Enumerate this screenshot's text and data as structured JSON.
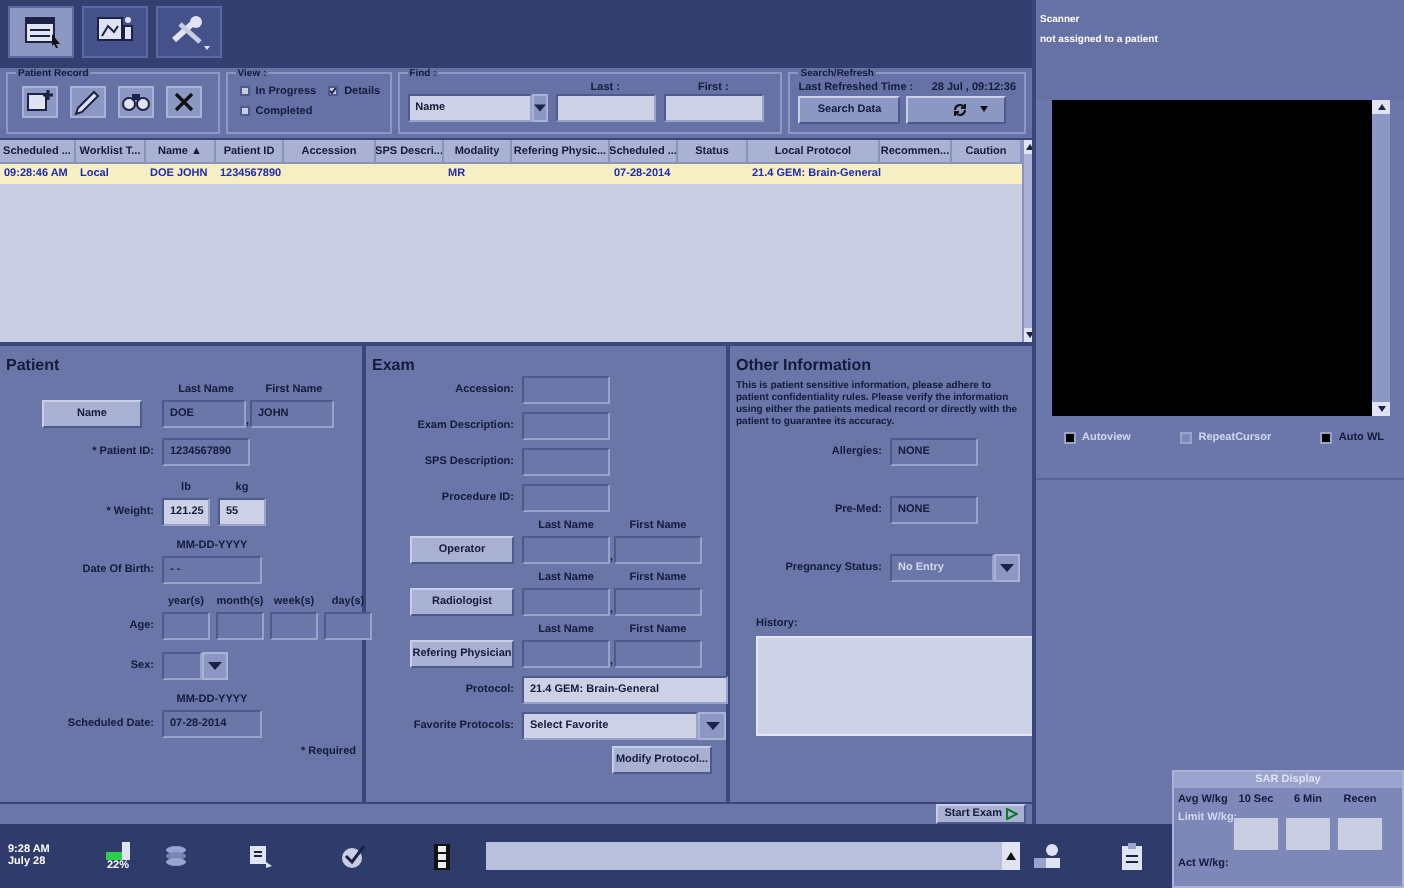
{
  "toolbar": [
    {
      "selected": true
    },
    {
      "selected": false
    },
    {
      "selected": false
    }
  ],
  "patient_record": {
    "title": "Patient Record"
  },
  "view": {
    "title": "View :",
    "options": [
      {
        "label": "In Progress",
        "checked": false
      },
      {
        "label": "Details",
        "checked": true
      },
      {
        "label": "Completed",
        "checked": false
      }
    ]
  },
  "find": {
    "title": "Find :",
    "field": "Name",
    "last_label": "Last :",
    "first_label": "First :"
  },
  "search_refresh": {
    "title": "Search/Refresh",
    "time_label": "Last Refreshed Time :",
    "time_value": "28 Jul , 09:12:36",
    "search_button": "Search Data"
  },
  "worklist": {
    "columns": [
      "Scheduled ...",
      "Worklist T...",
      "Name ▲",
      "Patient ID",
      "Accession",
      "SPS Descri...",
      "Modality",
      "Refering Physic...",
      "Scheduled ...",
      "Status",
      "Local Protocol",
      "Recommen...",
      "Caution"
    ],
    "rows": [
      {
        "selected": true,
        "scheduled_time": "09:28:46 AM",
        "worklist_type": "Local",
        "patient_name": "DOE JOHN",
        "patient_id": "1234567890",
        "modality": "MR",
        "scheduled_date": "07-28-2014",
        "local_protocol": "21.4 GEM: Brain-General"
      }
    ]
  },
  "patient": {
    "title": "Patient",
    "last_name_label": "Last Name",
    "first_name_label": "First Name",
    "name_button": "Name",
    "last_name": "DOE",
    "separator": ",",
    "first_name": "JOHN",
    "id_label": "* Patient ID:",
    "id": "1234567890",
    "lb_label": "lb",
    "kg_label": "kg",
    "weight_label": "* Weight:",
    "weight_lb": "121.25",
    "weight_kg": "55",
    "dob_format": "MM-DD-YYYY",
    "dob_label": "Date Of Birth:",
    "dob": "- -",
    "age_units": [
      "year(s)",
      "month(s)",
      "week(s)",
      "day(s)"
    ],
    "age_label": "Age:",
    "sex_label": "Sex:",
    "sched_format": "MM-DD-YYYY",
    "sched_label": "Scheduled Date:",
    "sched_date": "07-28-2014",
    "required_note": "* Required"
  },
  "exam": {
    "title": "Exam",
    "fields": [
      {
        "label": "Accession:"
      },
      {
        "label": "Exam Description:"
      },
      {
        "label": "SPS Description:"
      },
      {
        "label": "Procedure ID:"
      }
    ],
    "people": [
      {
        "button": "Operator",
        "last_label": "Last Name",
        "first_label": "First Name",
        "separator": ","
      },
      {
        "button": "Radiologist",
        "last_label": "Last Name",
        "first_label": "First Name",
        "separator": ","
      },
      {
        "button": "Refering Physician",
        "last_label": "Last Name",
        "first_label": "First Name",
        "separator": ","
      }
    ],
    "protocol_label": "Protocol:",
    "protocol": "21.4 GEM: Brain-General",
    "favorite_label": "Favorite Protocols:",
    "favorite": "Select Favorite",
    "modify_button": "Modify Protocol..."
  },
  "other": {
    "title": "Other Information",
    "notice": "This is patient sensitive information, please adhere to patient confidentiality rules. Please verify the information using either the patients medical record or directly with the patient to guarantee its accuracy.",
    "allergies_label": "Allergies:",
    "allergies": "NONE",
    "premed_label": "Pre-Med:",
    "premed": "NONE",
    "pregnancy_label": "Pregnancy Status:",
    "pregnancy": "No Entry",
    "pregnancy_disabled": true,
    "history_label": "History:"
  },
  "start_exam": "Start Exam",
  "scanner": {
    "title": "Scanner",
    "status": "not assigned to a patient",
    "options": [
      {
        "label": "Autoview",
        "checked": true,
        "disabled": true
      },
      {
        "label": "RepeatCursor",
        "checked": false,
        "disabled": true
      },
      {
        "label": "Auto WL",
        "checked": true,
        "disabled": false
      }
    ]
  },
  "sar": {
    "title": "SAR Display",
    "row_label": "Avg W/kg",
    "columns": [
      "10 Sec",
      "6 Min",
      "Recen"
    ],
    "limit_label": "Limit W/kg:",
    "act_label": "Act W/kg:"
  },
  "taskbar": {
    "time": "9:28 AM",
    "date": "July 28",
    "battery": "22%"
  }
}
